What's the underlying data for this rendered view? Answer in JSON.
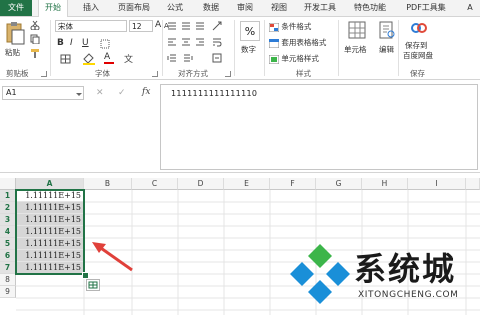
{
  "tabs": [
    "文件",
    "开始",
    "插入",
    "页面布局",
    "公式",
    "数据",
    "审阅",
    "视图",
    "开发工具",
    "特色功能",
    "PDF工具集",
    "A"
  ],
  "ribbon": {
    "paste": "粘贴",
    "clipboard": "剪贴板",
    "font_name": "宋体",
    "font_size": "12",
    "font_group": "字体",
    "align_group": "对齐方式",
    "number_btn": "数字",
    "cond_format": "条件格式",
    "table_format": "套用表格格式",
    "cell_style": "单元格样式",
    "style_group": "样式",
    "cells_btn": "单元格",
    "edit_btn": "编辑",
    "save_to": "保存到",
    "baidu_pan": "百度网盘",
    "save_group": "保存",
    "bold": "B",
    "italic": "I",
    "underline": "U",
    "grow": "A",
    "shrink": "A",
    "font_color": "A",
    "percent": "%",
    "wen": "文"
  },
  "formula_bar": {
    "name_box": "A1",
    "fx": "fx",
    "value": "1111111111111110"
  },
  "grid": {
    "columns": [
      "A",
      "B",
      "C",
      "D",
      "E",
      "F",
      "G",
      "H",
      "I"
    ],
    "rows": [
      "1",
      "2",
      "3",
      "4",
      "5",
      "6",
      "7",
      "8",
      "9"
    ],
    "a_values": [
      "1.11111E+15",
      "1.11111E+15",
      "1.11111E+15",
      "1.11111E+15",
      "1.11111E+15",
      "1.11111E+15",
      "1.11111E+15"
    ]
  },
  "watermark": {
    "title": "系统城",
    "url": "XITONGCHENG.COM"
  },
  "colors": {
    "accent": "#217346",
    "arrow": "#e0403a",
    "logo_blue": "#1a8fd8",
    "logo_green": "#3cb54a"
  }
}
